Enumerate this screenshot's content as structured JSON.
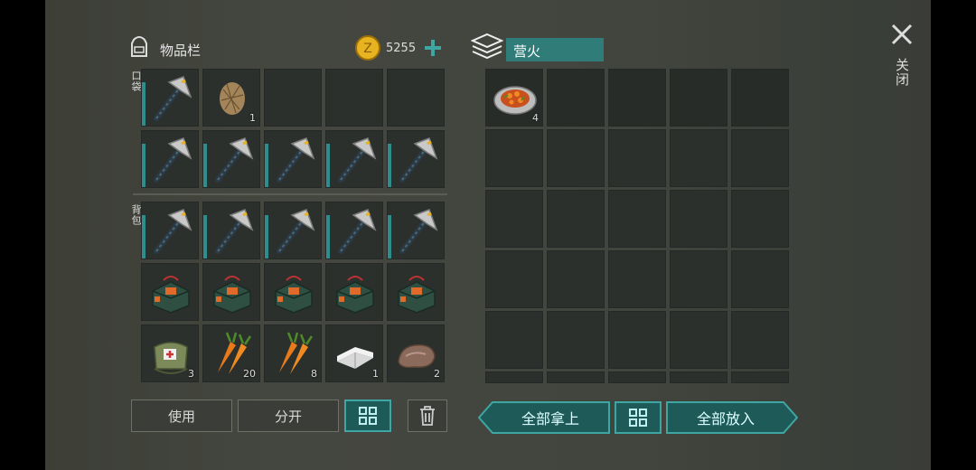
{
  "inventory": {
    "title": "物品栏",
    "coins": "5255",
    "pocket_label": "口袋",
    "backpack_label": "背包"
  },
  "container": {
    "title": "营火"
  },
  "close_label": "关闭",
  "slots": {
    "pocket_row1": [
      {
        "item": "pickaxe",
        "count": ""
      },
      {
        "item": "hay",
        "count": "1"
      },
      {
        "item": "",
        "count": ""
      },
      {
        "item": "",
        "count": ""
      },
      {
        "item": "",
        "count": ""
      }
    ],
    "pocket_row2": [
      {
        "item": "pickaxe",
        "count": ""
      },
      {
        "item": "pickaxe",
        "count": ""
      },
      {
        "item": "pickaxe",
        "count": ""
      },
      {
        "item": "pickaxe",
        "count": ""
      },
      {
        "item": "pickaxe",
        "count": ""
      }
    ],
    "backpack_row1": [
      {
        "item": "pickaxe",
        "count": ""
      },
      {
        "item": "pickaxe",
        "count": ""
      },
      {
        "item": "pickaxe",
        "count": ""
      },
      {
        "item": "pickaxe",
        "count": ""
      },
      {
        "item": "pickaxe",
        "count": ""
      }
    ],
    "backpack_row2": [
      {
        "item": "medkit",
        "count": ""
      },
      {
        "item": "medkit",
        "count": ""
      },
      {
        "item": "medkit",
        "count": ""
      },
      {
        "item": "medkit",
        "count": ""
      },
      {
        "item": "medkit",
        "count": ""
      }
    ],
    "backpack_row3": [
      {
        "item": "first-aid-bag",
        "count": "3"
      },
      {
        "item": "carrots",
        "count": "20"
      },
      {
        "item": "carrots",
        "count": "8"
      },
      {
        "item": "iron-ingot",
        "count": "1"
      },
      {
        "item": "stone",
        "count": "2"
      }
    ],
    "campfire_first": {
      "item": "cooked-food",
      "count": "4"
    }
  },
  "buttons": {
    "use": "使用",
    "split": "分开",
    "take_all": "全部拿上",
    "put_all": "全部放入"
  },
  "colors": {
    "accent": "#3ea7a3",
    "coin": "#e8b320"
  }
}
